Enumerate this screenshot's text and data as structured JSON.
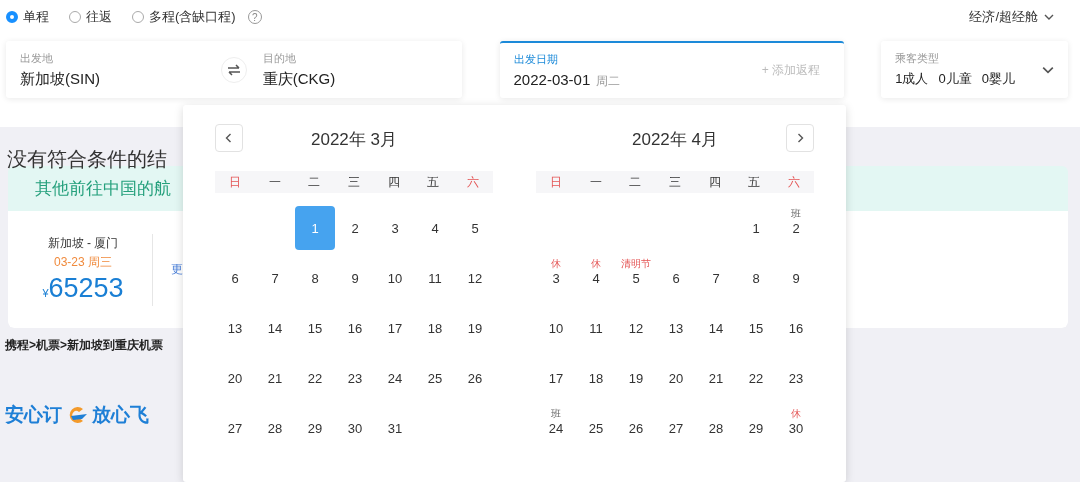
{
  "trip_types": [
    {
      "label": "单程",
      "selected": true
    },
    {
      "label": "往返",
      "selected": false
    },
    {
      "label": "多程(含缺口程)",
      "selected": false
    }
  ],
  "help": {
    "symbol": "?"
  },
  "cabin": {
    "value": "经济/超经舱"
  },
  "route": {
    "origin": {
      "label": "出发地",
      "value": "新加坡(SIN)"
    },
    "destination": {
      "label": "目的地",
      "value": "重庆(CKG)"
    }
  },
  "date_field": {
    "label": "出发日期",
    "value": "2022-03-01",
    "weekday": "周二",
    "focused": true,
    "add_return": "+ 添加返程"
  },
  "passengers": {
    "label": "乘客类型",
    "adults": "1成人",
    "children": "0儿童",
    "infants": "0婴儿"
  },
  "results": {
    "heading": "没有符合条件的结",
    "banner": "其他前往中国的航",
    "card": {
      "route": "新加坡 - 厦门",
      "date": "03-23 周三",
      "currency": "¥",
      "price": "65253",
      "more_link": "更"
    }
  },
  "breadcrumb": "携程>机票>新加坡到重庆机票",
  "logo": {
    "left": "安心订",
    "right": "放心飞"
  },
  "calendar": {
    "months": [
      {
        "title": "2022年 3月",
        "weekdays": [
          {
            "label": "日",
            "weekend": true
          },
          {
            "label": "一",
            "weekend": false
          },
          {
            "label": "二",
            "weekend": false
          },
          {
            "label": "三",
            "weekend": false
          },
          {
            "label": "四",
            "weekend": false
          },
          {
            "label": "五",
            "weekend": false
          },
          {
            "label": "六",
            "weekend": true
          }
        ],
        "weeks": [
          [
            {
              "day": "1",
              "selected": true
            },
            {
              "day": "2",
              "selected": false
            },
            {
              "day": "3",
              "selected": false
            },
            {
              "day": "4",
              "selected": false
            },
            {
              "day": "5",
              "selected": false
            }
          ],
          [
            {
              "day": "6",
              "selected": false
            },
            {
              "day": "7",
              "selected": false
            },
            {
              "day": "8",
              "selected": false
            },
            {
              "day": "9",
              "selected": false
            },
            {
              "day": "10",
              "selected": false
            },
            {
              "day": "11",
              "selected": false
            },
            {
              "day": "12",
              "selected": false
            }
          ],
          [
            {
              "day": "13",
              "selected": false
            },
            {
              "day": "14",
              "selected": false
            },
            {
              "day": "15",
              "selected": false
            },
            {
              "day": "16",
              "selected": false
            },
            {
              "day": "17",
              "selected": false
            },
            {
              "day": "18",
              "selected": false
            },
            {
              "day": "19",
              "selected": false
            }
          ],
          [
            {
              "day": "20",
              "selected": false
            },
            {
              "day": "21",
              "selected": false
            },
            {
              "day": "22",
              "selected": false
            },
            {
              "day": "23",
              "selected": false
            },
            {
              "day": "24",
              "selected": false
            },
            {
              "day": "25",
              "selected": false
            },
            {
              "day": "26",
              "selected": false
            }
          ],
          [
            {
              "day": "27",
              "selected": false
            },
            {
              "day": "28",
              "selected": false
            },
            {
              "day": "29",
              "selected": false
            },
            {
              "day": "30",
              "selected": false
            },
            {
              "day": "31",
              "selected": false
            }
          ]
        ]
      },
      {
        "title": "2022年 4月",
        "weekdays": [
          {
            "label": "日",
            "weekend": true
          },
          {
            "label": "一",
            "weekend": false
          },
          {
            "label": "二",
            "weekend": false
          },
          {
            "label": "三",
            "weekend": false
          },
          {
            "label": "四",
            "weekend": false
          },
          {
            "label": "五",
            "weekend": false
          },
          {
            "label": "六",
            "weekend": true
          }
        ],
        "weeks": [
          [
            {
              "day": "1",
              "selected": false
            },
            {
              "day": "2",
              "selected": false,
              "note": {
                "text": "班",
                "kind": "work"
              }
            }
          ],
          [
            {
              "day": "3",
              "selected": false,
              "note": {
                "text": "休",
                "kind": "rest"
              }
            },
            {
              "day": "4",
              "selected": false,
              "note": {
                "text": "休",
                "kind": "rest"
              }
            },
            {
              "day": "5",
              "selected": false,
              "note": {
                "text": "清明节",
                "kind": "festival"
              }
            },
            {
              "day": "6",
              "selected": false
            },
            {
              "day": "7",
              "selected": false
            },
            {
              "day": "8",
              "selected": false
            },
            {
              "day": "9",
              "selected": false
            }
          ],
          [
            {
              "day": "10",
              "selected": false
            },
            {
              "day": "11",
              "selected": false
            },
            {
              "day": "12",
              "selected": false
            },
            {
              "day": "13",
              "selected": false
            },
            {
              "day": "14",
              "selected": false
            },
            {
              "day": "15",
              "selected": false
            },
            {
              "day": "16",
              "selected": false
            }
          ],
          [
            {
              "day": "17",
              "selected": false
            },
            {
              "day": "18",
              "selected": false
            },
            {
              "day": "19",
              "selected": false
            },
            {
              "day": "20",
              "selected": false
            },
            {
              "day": "21",
              "selected": false
            },
            {
              "day": "22",
              "selected": false
            },
            {
              "day": "23",
              "selected": false
            }
          ],
          [
            {
              "day": "24",
              "selected": false,
              "note": {
                "text": "班",
                "kind": "work"
              }
            },
            {
              "day": "25",
              "selected": false
            },
            {
              "day": "26",
              "selected": false
            },
            {
              "day": "27",
              "selected": false
            },
            {
              "day": "28",
              "selected": false
            },
            {
              "day": "29",
              "selected": false
            },
            {
              "day": "30",
              "selected": false,
              "note": {
                "text": "休",
                "kind": "rest"
              }
            }
          ]
        ]
      }
    ]
  }
}
